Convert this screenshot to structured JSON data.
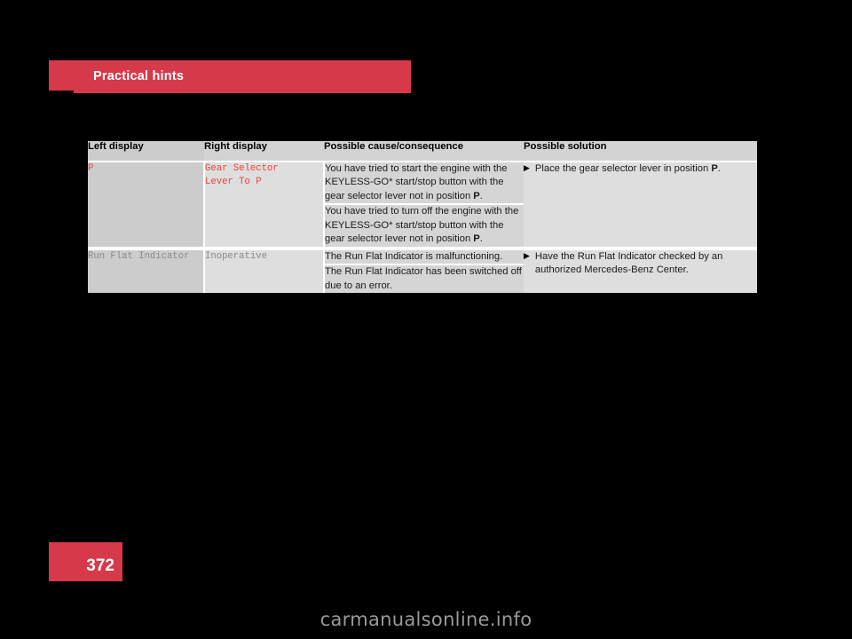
{
  "section": {
    "title": "Practical hints"
  },
  "page": {
    "number": "372",
    "watermark": "carmanualsonline.info"
  },
  "colors": {
    "accent_red": "#d6394a",
    "display_red_text": "#ee4337",
    "display_grey_text": "#8a8a8a",
    "col1_bg": "#cccccc",
    "col2_bg": "#dedede",
    "cause_bg": "#d5d5d5",
    "solution_bg": "#dedede",
    "header_bg": "#cccccc"
  },
  "table": {
    "headers": [
      "Left display",
      "Right display",
      "Possible cause/consequence",
      "Possible solution"
    ],
    "rows": [
      {
        "left_display": [
          "P"
        ],
        "left_display_style": "red",
        "right_display": [
          "Gear Selector",
          "Lever To P"
        ],
        "right_display_style": "red",
        "causes": [
          "You have tried to start the engine with the KEYLESS-GO* start/stop button with the gear selector lever not in position P.",
          "You have tried to turn off the engine with the KEYLESS-GO* start/stop button with the gear selector lever not in position P."
        ],
        "solutions": [
          "Place the gear selector lever in position P."
        ],
        "bullet": "▶"
      },
      {
        "left_display": [
          "Run Flat Indicator"
        ],
        "left_display_style": "grey",
        "right_display": [
          "Inoperative"
        ],
        "right_display_style": "grey",
        "causes": [
          "The Run Flat Indicator is malfunctioning.",
          "The Run Flat Indicator has been switched off due to an error."
        ],
        "solutions": [
          "Have the Run Flat Indicator checked by an authorized Mercedes-Benz Center."
        ],
        "bullet": "▶"
      }
    ]
  }
}
